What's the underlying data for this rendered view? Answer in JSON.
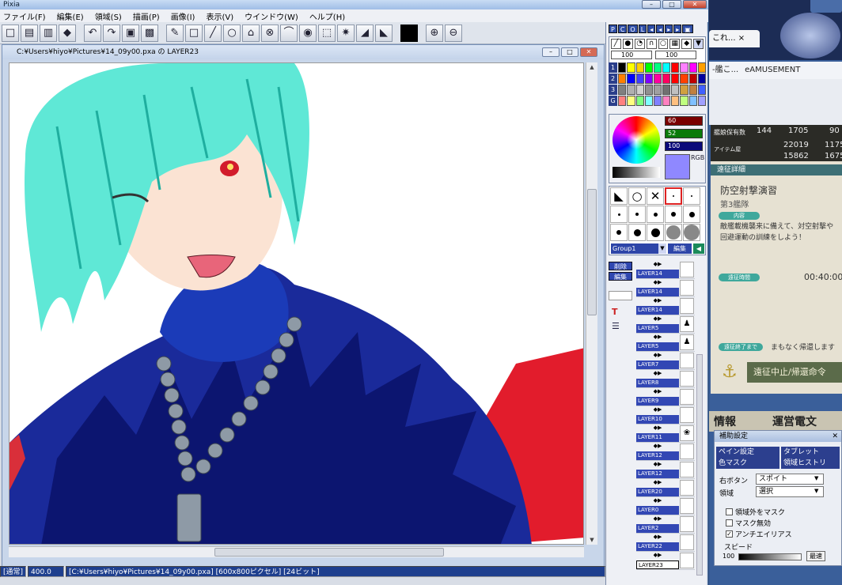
{
  "app": {
    "title": "Pixia",
    "controls": {
      "minimize": "–",
      "maximize": "□",
      "close": "✕"
    }
  },
  "menu": [
    "ファイル(F)",
    "編集(E)",
    "領域(S)",
    "描画(P)",
    "画像(I)",
    "表示(V)",
    "ウインドウ(W)",
    "ヘルプ(H)"
  ],
  "toolbar": {
    "icons": [
      "new-file-icon",
      "open-file-icon",
      "save-file-icon",
      "print-icon",
      "undo-icon",
      "redo-icon",
      "copy-icon",
      "paste-icon",
      "pen-icon",
      "rectangle-icon",
      "line-icon",
      "circle-icon",
      "polygon-icon",
      "lasso-icon",
      "curve-icon",
      "fill-icon",
      "select-icon",
      "transform-icon",
      "bucket-icon",
      "eraser-icon",
      "color-icon",
      "zoom-in-icon",
      "zoom-out-icon"
    ],
    "glyphs": [
      "□",
      "▤",
      "▥",
      "◆",
      "↶",
      "↷",
      "▣",
      "▩",
      "✎",
      "□",
      "╱",
      "○",
      "⌂",
      "⊗",
      "⌒",
      "◉",
      "⬚",
      "✷",
      "◢",
      "◣",
      "",
      "⊕",
      "⊖"
    ]
  },
  "document": {
    "title": "C:¥Users¥hiyo¥Pictures¥14_09y00.pxa の LAYER23"
  },
  "status": {
    "mode": "[通常]",
    "zoom": "400.0",
    "info": "[C:¥Users¥hiyo¥Pictures¥14_09y00.pxa] [600x800ピクセル] [24ビット]"
  },
  "palette": {
    "modes": [
      "P",
      "C",
      "O",
      "L",
      "◂",
      "◂",
      "▸",
      "▸",
      "▣"
    ],
    "size_a": "100",
    "size_b": "100",
    "tabs": [
      "1",
      "2",
      "3",
      "G"
    ],
    "rows": [
      [
        "#000000",
        "#ffff00",
        "#ffd000",
        "#00ff00",
        "#00ff80",
        "#00ffff",
        "#ff0000",
        "#ff80ff",
        "#ff00ff",
        "#ffa000"
      ],
      [
        "#ff8000",
        "#0000ff",
        "#4040ff",
        "#8000ff",
        "#ff00a0",
        "#ff0060",
        "#ff0000",
        "#ff4000",
        "#c00000",
        "#0000a0"
      ],
      [
        "#808080",
        "#b0b0b0",
        "#d0d0d0",
        "#909090",
        "#a0a0a0",
        "#707070",
        "#c0c0c0",
        "#d0a040",
        "#c08040",
        "#4060ff"
      ],
      [
        "#ff8080",
        "#ffff80",
        "#80ff80",
        "#80ffff",
        "#8080ff",
        "#ff80c0",
        "#ffc080",
        "#c0ff80",
        "#80c0ff",
        "#a0a0ff"
      ]
    ],
    "color_values": {
      "r": "60",
      "g": "52",
      "b": "100"
    },
    "current_color": "#8f88ff",
    "rgb_label": "RGB"
  },
  "brushes": {
    "group": "Group1",
    "edit_label": "編集"
  },
  "layers": {
    "delete_label": "削除",
    "edit_label": "編集",
    "items": [
      {
        "name": "LAYER14",
        "thumb": ""
      },
      {
        "name": "LAYER14",
        "thumb": ""
      },
      {
        "name": "LAYER14",
        "thumb": ""
      },
      {
        "name": "LAYER5",
        "thumb": "♟"
      },
      {
        "name": "LAYER5",
        "thumb": "♟"
      },
      {
        "name": "LAYER7",
        "thumb": ""
      },
      {
        "name": "LAYER8",
        "thumb": ""
      },
      {
        "name": "LAYER9",
        "thumb": ""
      },
      {
        "name": "LAYER10",
        "thumb": ""
      },
      {
        "name": "LAYER11",
        "thumb": "❀"
      },
      {
        "name": "LAYER12",
        "thumb": ""
      },
      {
        "name": "LAYER12",
        "thumb": ""
      },
      {
        "name": "LAYER20",
        "thumb": ""
      },
      {
        "name": "LAYER0",
        "thumb": ""
      },
      {
        "name": "LAYER2",
        "thumb": ""
      },
      {
        "name": "LAYER22",
        "thumb": ""
      },
      {
        "name": "LAYER23",
        "thumb": ""
      }
    ]
  },
  "browser": {
    "tab": "これ... ×",
    "bookmarks": [
      "-艦こ...",
      "eAMUSEMENT"
    ],
    "game": {
      "ships": "144",
      "fuel": "1705",
      "ammo": "90",
      "steel": "22019",
      "bauxite": "1175",
      "res3": "15862",
      "res4": "1675",
      "ship_label": "艦娘保有数",
      "item_label": "アイテム屋",
      "expedition_header": "遠征詳細",
      "mission_title": "防空射撃演習",
      "fleet": "第3艦隊",
      "content_chip": "内容",
      "content_text": "敵艦載機襲来に備えて、対空射撃や回避運動の訓練をしよう！",
      "time_chip": "遠征時間",
      "time": "00:40:00",
      "end_chip": "遠征終了まで",
      "end_text": "まもなく帰還します",
      "recall_button": "遠征中止/帰還命令",
      "info_tab": "情報",
      "news_tab": "運営電文"
    }
  },
  "aux_panel": {
    "title": "補助設定",
    "tabs": [
      "ペイン設定",
      "タブレット",
      "色マスク",
      "領域ヒストリ"
    ],
    "right_button_label": "右ボタン",
    "right_button_value": "スポイト",
    "region_label": "領域",
    "region_value": "選択",
    "checks": [
      {
        "label": "領域外をマスク",
        "checked": false
      },
      {
        "label": "マスク無効",
        "checked": false
      },
      {
        "label": "アンチエイリアス",
        "checked": true
      }
    ],
    "speed_label": "スピード",
    "speed_value": "100",
    "apply_button": "最速"
  }
}
